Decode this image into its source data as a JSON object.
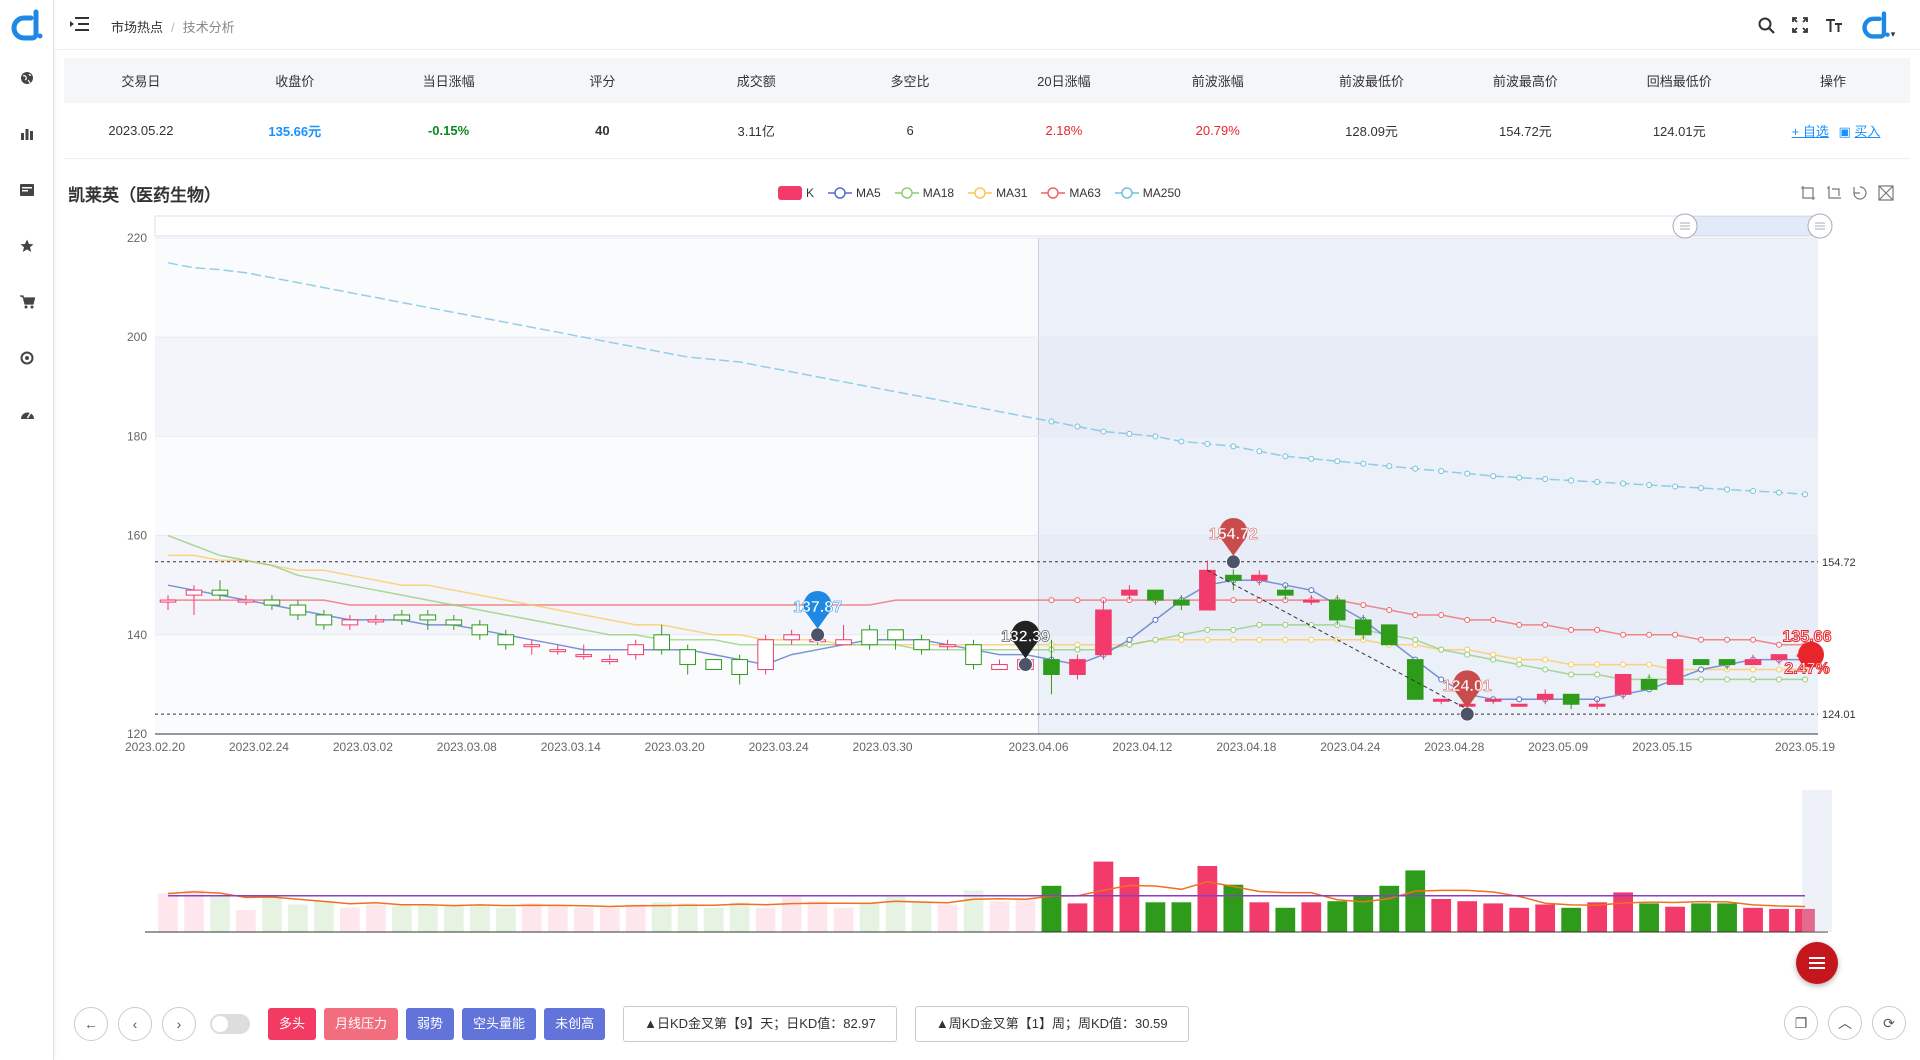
{
  "breadcrumb": {
    "parent": "市场热点",
    "current": "技术分析"
  },
  "summary": {
    "headers": [
      "交易日",
      "收盘价",
      "当日涨幅",
      "评分",
      "成交额",
      "多空比",
      "20日涨幅",
      "前波涨幅",
      "前波最低价",
      "前波最高价",
      "回档最低价",
      "操作"
    ],
    "row": {
      "date": "2023.05.22",
      "close": "135.66元",
      "day_change": "-0.15%",
      "score": "40",
      "turnover": "3.11亿",
      "ratio": "6",
      "change_20d": "2.18%",
      "wave_change": "20.79%",
      "wave_low": "128.09元",
      "wave_high": "154.72元",
      "pullback_low": "124.01元"
    },
    "op_watch": "+ 自选",
    "op_buy": "买入"
  },
  "stock_title": "凯莱英（医药生物）",
  "legend": [
    {
      "label": "K",
      "color": "#f23b6b"
    },
    {
      "label": "MA5",
      "color": "#5470c6"
    },
    {
      "label": "MA18",
      "color": "#91cc75"
    },
    {
      "label": "MA31",
      "color": "#fac858"
    },
    {
      "label": "MA63",
      "color": "#ee6666"
    },
    {
      "label": "MA250",
      "color": "#73c0de"
    }
  ],
  "chart_data": {
    "type": "candlestick",
    "y_ticks": [
      "220",
      "200",
      "180",
      "160",
      "140",
      "120"
    ],
    "ylim": [
      120,
      220
    ],
    "x_ticks": [
      "2023.02.20",
      "2023.02.24",
      "2023.03.02",
      "2023.03.08",
      "2023.03.14",
      "2023.03.20",
      "2023.03.24",
      "2023.03.30",
      "2023.04.06",
      "2023.04.12",
      "2023.04.18",
      "2023.04.24",
      "2023.04.28",
      "2023.05.09",
      "2023.05.15",
      "2023.05.19"
    ],
    "candles": [
      [
        147,
        147,
        145,
        148
      ],
      [
        148,
        149,
        144,
        150
      ],
      [
        149,
        148,
        147,
        151
      ],
      [
        147,
        147,
        146,
        148
      ],
      [
        147,
        146,
        145,
        148
      ],
      [
        146,
        144,
        143,
        147
      ],
      [
        144,
        142,
        141,
        145
      ],
      [
        142,
        143,
        141,
        144
      ],
      [
        143,
        143,
        142,
        144
      ],
      [
        144,
        143,
        142,
        145
      ],
      [
        144,
        143,
        141,
        145
      ],
      [
        143,
        142,
        141,
        144
      ],
      [
        142,
        140,
        139,
        143
      ],
      [
        140,
        138,
        137,
        141
      ],
      [
        138,
        138,
        136,
        139
      ],
      [
        137,
        137,
        136,
        138
      ],
      [
        136,
        136,
        135,
        138
      ],
      [
        135,
        135,
        134,
        136
      ],
      [
        136,
        138,
        135,
        139
      ],
      [
        140,
        137,
        136,
        142
      ],
      [
        137,
        134,
        132,
        138
      ],
      [
        135,
        133,
        133,
        135
      ],
      [
        135,
        132,
        130,
        136
      ],
      [
        133,
        139,
        132,
        140
      ],
      [
        139,
        140,
        138,
        141
      ],
      [
        139,
        139,
        138,
        141
      ],
      [
        138,
        139,
        138,
        142
      ],
      [
        141,
        138,
        137,
        142
      ],
      [
        141,
        139,
        137,
        141
      ],
      [
        139,
        137,
        136,
        140
      ],
      [
        138,
        138,
        137,
        139
      ],
      [
        138,
        134,
        133,
        139
      ],
      [
        133,
        134,
        133,
        135
      ],
      [
        133,
        135,
        134,
        136
      ],
      [
        135,
        132,
        128,
        139
      ],
      [
        132,
        135,
        131,
        136
      ],
      [
        136,
        145,
        135,
        147
      ],
      [
        148,
        149,
        147,
        150
      ],
      [
        149,
        147,
        146,
        149
      ],
      [
        147,
        146,
        145,
        148
      ],
      [
        145,
        153,
        145,
        155
      ],
      [
        152,
        151,
        149,
        155
      ],
      [
        151,
        152,
        150,
        153
      ],
      [
        149,
        148,
        147,
        150
      ],
      [
        147,
        147,
        146,
        148
      ],
      [
        147,
        143,
        142,
        148
      ],
      [
        143,
        140,
        139,
        144
      ],
      [
        142,
        138,
        138,
        142
      ],
      [
        135,
        127,
        127,
        135
      ],
      [
        127,
        127,
        126,
        127
      ],
      [
        126,
        126,
        124,
        127
      ],
      [
        127,
        127,
        126,
        127
      ],
      [
        126,
        126,
        126,
        126
      ],
      [
        127,
        128,
        126,
        129
      ],
      [
        128,
        126,
        125,
        128
      ],
      [
        126,
        126,
        125,
        127
      ],
      [
        128,
        132,
        127,
        132
      ],
      [
        131,
        129,
        129,
        132
      ],
      [
        130,
        135,
        130,
        135
      ],
      [
        135,
        134,
        134,
        135
      ],
      [
        135,
        134,
        133,
        135
      ],
      [
        134,
        135,
        134,
        136
      ],
      [
        135,
        136,
        134,
        136
      ],
      [
        136,
        136,
        135,
        137
      ]
    ],
    "ma5": [
      150,
      149,
      148,
      147,
      146,
      145,
      144,
      143,
      143,
      143,
      142,
      142,
      141,
      140,
      139,
      138,
      137,
      137,
      137,
      137,
      137,
      136,
      135,
      134,
      136,
      137,
      138,
      139,
      139,
      139,
      138,
      137,
      136,
      136,
      135,
      134,
      136,
      139,
      143,
      147,
      150,
      151,
      151,
      150,
      149,
      146,
      143,
      139,
      135,
      131,
      128,
      127,
      127,
      127,
      127,
      127,
      128,
      129,
      131,
      133,
      134,
      135,
      135,
      135
    ],
    "ma18": [
      160,
      158,
      156,
      155,
      154,
      152,
      151,
      150,
      149,
      148,
      147,
      146,
      145,
      144,
      143,
      142,
      141,
      140,
      140,
      139,
      139,
      139,
      138,
      138,
      138,
      138,
      138,
      138,
      138,
      137,
      137,
      137,
      137,
      137,
      137,
      137,
      137,
      138,
      139,
      140,
      141,
      141,
      142,
      142,
      142,
      142,
      141,
      140,
      139,
      137,
      136,
      135,
      134,
      133,
      132,
      132,
      131,
      131,
      131,
      131,
      131,
      131,
      131,
      131
    ],
    "ma31": [
      156,
      156,
      155,
      155,
      154,
      153,
      153,
      152,
      151,
      150,
      150,
      149,
      148,
      147,
      146,
      145,
      144,
      143,
      142,
      142,
      141,
      140,
      140,
      139,
      139,
      139,
      138,
      138,
      138,
      138,
      138,
      138,
      138,
      138,
      138,
      138,
      138,
      138,
      139,
      139,
      139,
      139,
      139,
      139,
      139,
      139,
      139,
      138,
      138,
      137,
      137,
      136,
      135,
      135,
      134,
      134,
      134,
      134,
      133,
      133,
      133,
      133,
      133,
      133
    ],
    "ma63": [
      147,
      147,
      147,
      147,
      147,
      147,
      147,
      146,
      146,
      146,
      146,
      146,
      146,
      146,
      146,
      146,
      146,
      146,
      146,
      146,
      146,
      146,
      146,
      146,
      146,
      146,
      146,
      146,
      147,
      147,
      147,
      147,
      147,
      147,
      147,
      147,
      147,
      147,
      147,
      147,
      147,
      147,
      147,
      147,
      147,
      147,
      146,
      145,
      144,
      144,
      143,
      143,
      142,
      142,
      141,
      141,
      140,
      140,
      140,
      139,
      139,
      139,
      138,
      138
    ],
    "ma250": [
      215,
      214,
      213.6,
      213,
      212,
      211,
      210,
      209,
      208,
      207,
      206,
      205,
      204,
      203,
      202,
      201,
      200,
      199,
      198,
      197,
      196,
      195.5,
      195,
      194,
      193,
      192,
      191,
      190,
      189,
      188,
      187,
      186,
      185,
      184,
      183,
      182,
      181,
      180.5,
      180,
      179,
      178.5,
      178,
      177,
      176,
      175.5,
      175,
      174.5,
      174,
      173.5,
      173,
      172.5,
      172,
      171.7,
      171.4,
      171.1,
      170.8,
      170.5,
      170.2,
      169.9,
      169.6,
      169.3,
      169,
      168.7,
      168.3
    ],
    "volumes": [
      0.35,
      0.38,
      0.33,
      0.2,
      0.33,
      0.25,
      0.28,
      0.22,
      0.25,
      0.24,
      0.25,
      0.24,
      0.25,
      0.22,
      0.26,
      0.24,
      0.22,
      0.22,
      0.25,
      0.27,
      0.26,
      0.22,
      0.27,
      0.22,
      0.32,
      0.28,
      0.22,
      0.26,
      0.32,
      0.28,
      0.25,
      0.38,
      0.28,
      0.3,
      0.42,
      0.26,
      0.64,
      0.5,
      0.27,
      0.27,
      0.6,
      0.43,
      0.27,
      0.22,
      0.27,
      0.28,
      0.33,
      0.42,
      0.56,
      0.3,
      0.28,
      0.26,
      0.22,
      0.25,
      0.22,
      0.27,
      0.36,
      0.26,
      0.23,
      0.26,
      0.26,
      0.22,
      0.21,
      0.21
    ],
    "annotations": [
      {
        "label": "137.87",
        "type": "low"
      },
      {
        "label": "132.39",
        "type": "pivot"
      },
      {
        "label": "154.72",
        "type": "high"
      },
      {
        "label": "124.01",
        "type": "low"
      },
      {
        "label": "135.66",
        "type": "current"
      },
      {
        "label": "2.47%",
        "type": "current-change"
      }
    ],
    "hlines": [
      "154.72",
      "124.01"
    ]
  },
  "bottom": {
    "tags": [
      {
        "label": "多头",
        "color": "#f33a62"
      },
      {
        "label": "月线压力",
        "color": "#f26d7d"
      },
      {
        "label": "弱势",
        "color": "#6273d9"
      },
      {
        "label": "空头量能",
        "color": "#6273d9"
      },
      {
        "label": "未创高",
        "color": "#6273d9"
      }
    ],
    "daily_kd": "▲日KD金叉第【9】天；日KD值：82.97",
    "weekly_kd": "▲周KD金叉第【1】周；周KD值：30.59"
  },
  "colors": {
    "up": "#f23b6b",
    "down": "#2e9c1a",
    "accent": "#1890ff"
  }
}
